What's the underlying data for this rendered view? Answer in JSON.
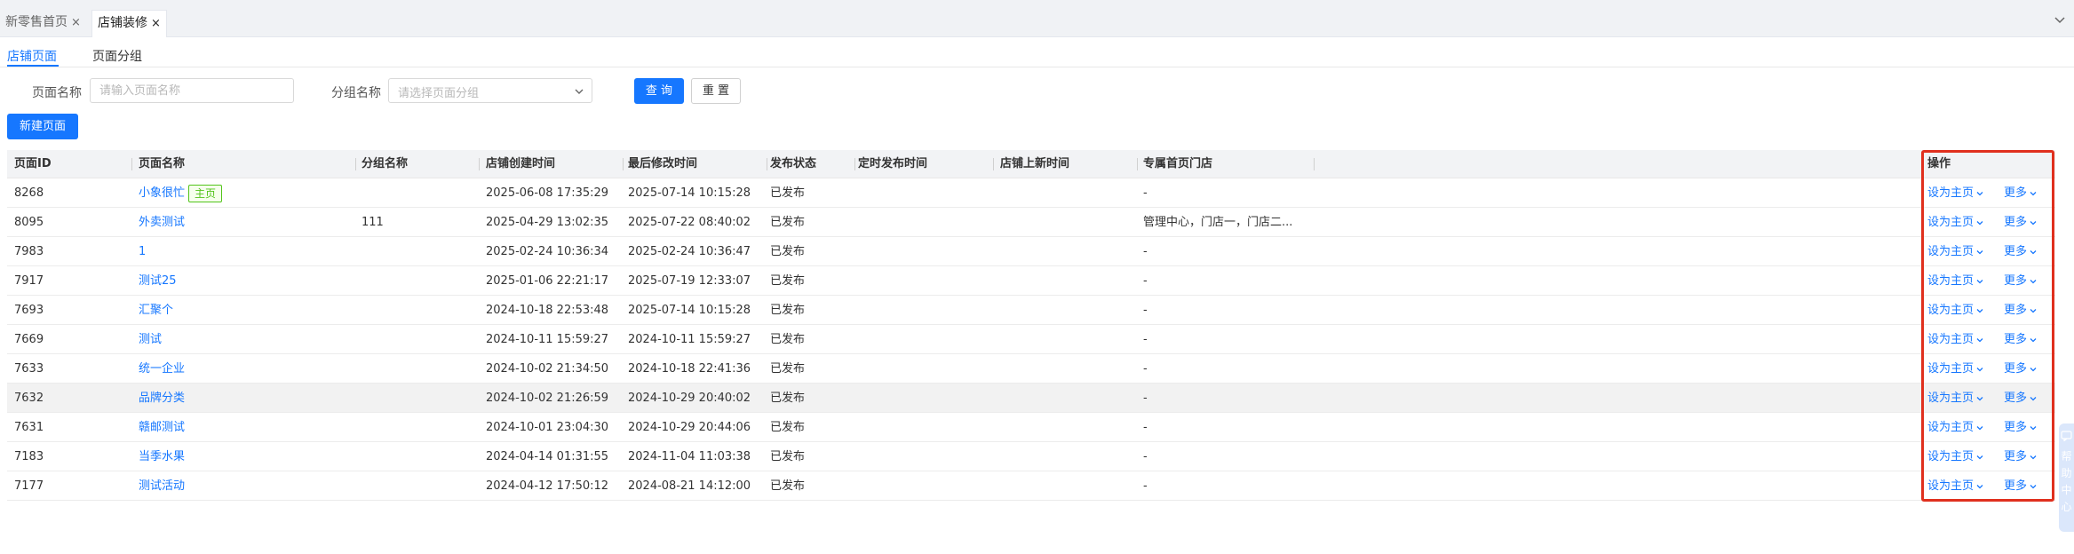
{
  "page_tabs": [
    {
      "label": "新零售首页",
      "close": "×"
    },
    {
      "label": "店铺装修",
      "close": "×"
    }
  ],
  "sub_tabs": [
    "店铺页面",
    "页面分组"
  ],
  "filters": {
    "page_name_label": "页面名称",
    "page_name_placeholder": "请输入页面名称",
    "group_name_label": "分组名称",
    "group_name_placeholder": "请选择页面分组",
    "query_label": "查 询",
    "reset_label": "重 置"
  },
  "new_page_label": "新建页面",
  "table": {
    "columns": [
      "页面ID",
      "页面名称",
      "分组名称",
      "店铺创建时间",
      "最后修改时间",
      "发布状态",
      "定时发布时间",
      "店铺上新时间",
      "专属首页门店",
      "操作"
    ],
    "home_tag": "主页",
    "rows": [
      {
        "id": "8268",
        "name": "小象很忙",
        "tag": "主页",
        "group": "",
        "created": "2025-06-08 17:35:29",
        "modified": "2025-07-14 10:15:28",
        "status": "已发布",
        "scheduled": "",
        "new_arrival": "",
        "stores": "-"
      },
      {
        "id": "8095",
        "name": "外卖测试",
        "tag": "",
        "group": "111",
        "created": "2025-04-29 13:02:35",
        "modified": "2025-07-22 08:40:02",
        "status": "已发布",
        "scheduled": "",
        "new_arrival": "",
        "stores": "管理中心，门店一，门店二..."
      },
      {
        "id": "7983",
        "name": "1",
        "tag": "",
        "group": "",
        "created": "2025-02-24 10:36:34",
        "modified": "2025-02-24 10:36:47",
        "status": "已发布",
        "scheduled": "",
        "new_arrival": "",
        "stores": "-"
      },
      {
        "id": "7917",
        "name": "测试25",
        "tag": "",
        "group": "",
        "created": "2025-01-06 22:21:17",
        "modified": "2025-07-19 12:33:07",
        "status": "已发布",
        "scheduled": "",
        "new_arrival": "",
        "stores": "-"
      },
      {
        "id": "7693",
        "name": "汇聚个",
        "tag": "",
        "group": "",
        "created": "2024-10-18 22:53:48",
        "modified": "2025-07-14 10:15:28",
        "status": "已发布",
        "scheduled": "",
        "new_arrival": "",
        "stores": "-"
      },
      {
        "id": "7669",
        "name": "测试",
        "tag": "",
        "group": "",
        "created": "2024-10-11 15:59:27",
        "modified": "2024-10-11 15:59:27",
        "status": "已发布",
        "scheduled": "",
        "new_arrival": "",
        "stores": "-"
      },
      {
        "id": "7633",
        "name": "统一企业",
        "tag": "",
        "group": "",
        "created": "2024-10-02 21:34:50",
        "modified": "2024-10-18 22:41:36",
        "status": "已发布",
        "scheduled": "",
        "new_arrival": "",
        "stores": "-"
      },
      {
        "id": "7632",
        "name": "品牌分类",
        "tag": "",
        "group": "",
        "created": "2024-10-02 21:26:59",
        "modified": "2024-10-29 20:40:02",
        "status": "已发布",
        "scheduled": "",
        "new_arrival": "",
        "stores": "-"
      },
      {
        "id": "7631",
        "name": "赣邮测试",
        "tag": "",
        "group": "",
        "created": "2024-10-01 23:04:30",
        "modified": "2024-10-29 20:44:06",
        "status": "已发布",
        "scheduled": "",
        "new_arrival": "",
        "stores": "-"
      },
      {
        "id": "7183",
        "name": "当季水果",
        "tag": "",
        "group": "",
        "created": "2024-04-14 01:31:55",
        "modified": "2024-11-04 11:03:38",
        "status": "已发布",
        "scheduled": "",
        "new_arrival": "",
        "stores": "-"
      },
      {
        "id": "7177",
        "name": "测试活动",
        "tag": "",
        "group": "",
        "created": "2024-04-12 17:50:12",
        "modified": "2024-08-21 14:12:00",
        "status": "已发布",
        "scheduled": "",
        "new_arrival": "",
        "stores": "-"
      }
    ],
    "highlighted_row_index": 7,
    "action_set_home": "设为主页",
    "action_more": "更多"
  },
  "help_widget": {
    "text": [
      "帮",
      "助",
      "中",
      "心"
    ],
    "icon": "chat-icon"
  },
  "colors": {
    "accent": "#1677ff",
    "highlight_border": "#e0301e",
    "tag_green": "#52c41a"
  }
}
